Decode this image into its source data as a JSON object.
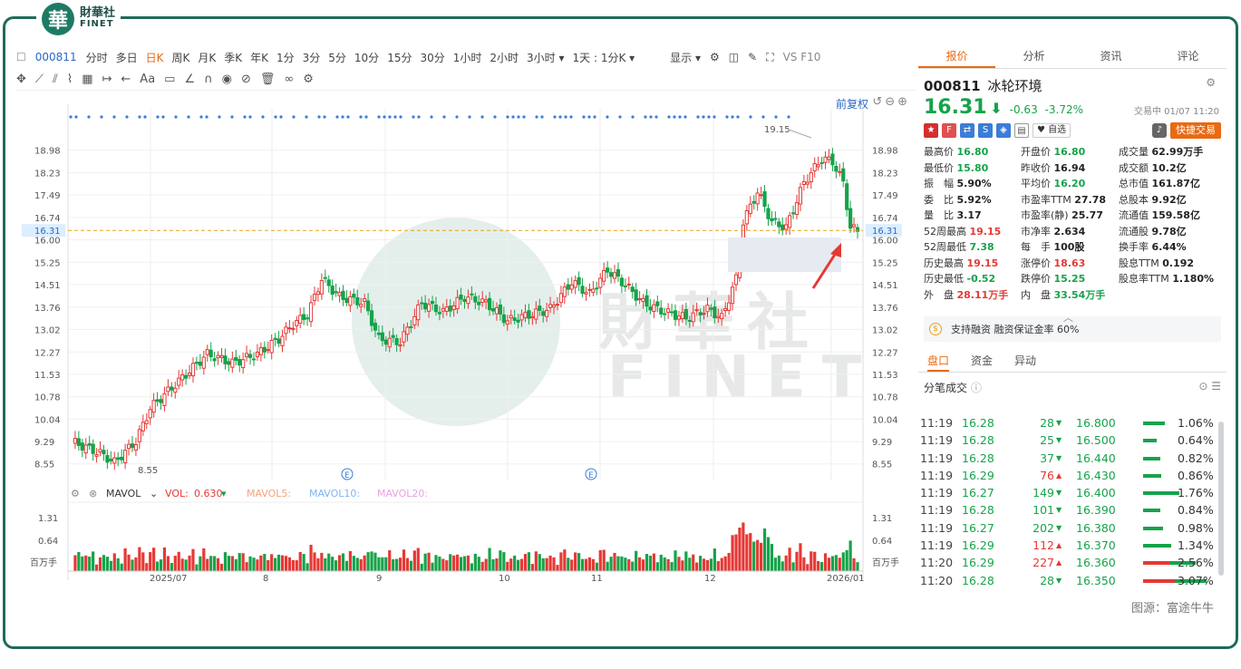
{
  "brand": {
    "logo_char": "華",
    "name_cn": "財華社",
    "name_en": "FINET",
    "watermark_cn": "財華社",
    "watermark_en": "FINET"
  },
  "toolbar": {
    "code": "000811",
    "items": [
      "分时",
      "多日",
      "日K",
      "周K",
      "月K",
      "季K",
      "年K",
      "1分",
      "3分",
      "5分",
      "10分",
      "15分",
      "30分",
      "1小时",
      "2小时",
      "3小时 ▾",
      "1天 : 1分K ▾"
    ],
    "active": "日K",
    "display": "显示 ▾",
    "right": "VS F10"
  },
  "chart": {
    "restore_label": "前复权",
    "y_ticks": [
      "18.98",
      "18.23",
      "17.49",
      "16.74",
      "16.00",
      "15.25",
      "14.51",
      "13.76",
      "13.02",
      "12.27",
      "11.53",
      "10.78",
      "10.04",
      "9.29",
      "8.55"
    ],
    "current_price_label": "16.31",
    "high_label": "19.15",
    "low_label": "8.55",
    "x_labels": [
      "2025/07",
      "8",
      "9",
      "10",
      "11",
      "12",
      "2026/01"
    ],
    "event_marker": "E"
  },
  "vol_panel": {
    "label": "MAVOL",
    "vol_label": "VOL:",
    "vol_value": "0.630",
    "ma5": "MAVOL5:",
    "ma10": "MAVOL10:",
    "ma20": "MAVOL20:",
    "y_ticks": [
      "1.31",
      "0.64"
    ],
    "unit": "百万手"
  },
  "right": {
    "tabs": [
      "报价",
      "分析",
      "资讯",
      "评论"
    ],
    "code": "000811",
    "name": "冰轮环境",
    "price": "16.31",
    "arrow": "⬇",
    "change": "-0.63",
    "change_pct": "-3.72%",
    "status": "交易中 01/07 11:20",
    "watch": "♥ 自选",
    "quick_trade": "快捷交易",
    "stats": [
      [
        "最高价",
        "16.80",
        "g"
      ],
      [
        "开盘价",
        "16.80",
        "g"
      ],
      [
        "成交量",
        "62.99万手",
        ""
      ],
      [
        "最低价",
        "15.80",
        "g"
      ],
      [
        "昨收价",
        "16.94",
        ""
      ],
      [
        "成交额",
        "10.2亿",
        ""
      ],
      [
        "振　幅",
        "5.90%",
        ""
      ],
      [
        "平均价",
        "16.20",
        "g"
      ],
      [
        "总市值",
        "161.87亿",
        ""
      ],
      [
        "委　比",
        "5.92%",
        ""
      ],
      [
        "市盈率TTM",
        "27.78",
        ""
      ],
      [
        "总股本",
        "9.92亿",
        ""
      ],
      [
        "量　比",
        "3.17",
        ""
      ],
      [
        "市盈率(静)",
        "25.77",
        ""
      ],
      [
        "流通值",
        "159.58亿",
        ""
      ],
      [
        "52周最高",
        "19.15",
        "r"
      ],
      [
        "市净率",
        "2.634",
        ""
      ],
      [
        "流通股",
        "9.78亿",
        ""
      ],
      [
        "52周最低",
        "7.38",
        "g"
      ],
      [
        "每　手",
        "100股",
        ""
      ],
      [
        "换手率",
        "6.44%",
        ""
      ],
      [
        "历史最高",
        "19.15",
        "r"
      ],
      [
        "涨停价",
        "18.63",
        "r"
      ],
      [
        "股息TTM",
        "0.192",
        ""
      ],
      [
        "历史最低",
        "-0.52",
        "g"
      ],
      [
        "跌停价",
        "15.25",
        "g"
      ],
      [
        "股息率TTM",
        "1.180%",
        ""
      ],
      [
        "外　盘",
        "28.11万手",
        "r"
      ],
      [
        "内　盘",
        "33.54万手",
        "g"
      ]
    ],
    "margin_text": "支持融资 融资保证金率 60%",
    "subtabs": [
      "盘口",
      "资金",
      "异动"
    ],
    "trades_title": "分笔成交",
    "trades": [
      {
        "time": "11:19",
        "price": "16.28",
        "vol": "28",
        "dir": "down"
      },
      {
        "time": "11:19",
        "price": "16.28",
        "vol": "25",
        "dir": "down"
      },
      {
        "time": "11:19",
        "price": "16.28",
        "vol": "37",
        "dir": "down"
      },
      {
        "time": "11:19",
        "price": "16.29",
        "vol": "76",
        "dir": "up"
      },
      {
        "time": "11:19",
        "price": "16.27",
        "vol": "149",
        "dir": "down"
      },
      {
        "time": "11:19",
        "price": "16.28",
        "vol": "101",
        "dir": "down"
      },
      {
        "time": "11:19",
        "price": "16.27",
        "vol": "202",
        "dir": "down"
      },
      {
        "time": "11:19",
        "price": "16.29",
        "vol": "112",
        "dir": "up"
      },
      {
        "time": "11:20",
        "price": "16.29",
        "vol": "227",
        "dir": "up"
      },
      {
        "time": "11:20",
        "price": "16.28",
        "vol": "28",
        "dir": "down"
      }
    ],
    "depth": [
      {
        "price": "16.800",
        "pct": "1.06%",
        "v": 1.06
      },
      {
        "price": "16.500",
        "pct": "0.64%",
        "v": 0.64
      },
      {
        "price": "16.440",
        "pct": "0.82%",
        "v": 0.82
      },
      {
        "price": "16.430",
        "pct": "0.86%",
        "v": 0.86
      },
      {
        "price": "16.400",
        "pct": "1.76%",
        "v": 1.76
      },
      {
        "price": "16.390",
        "pct": "0.84%",
        "v": 0.84
      },
      {
        "price": "16.380",
        "pct": "0.98%",
        "v": 0.98
      },
      {
        "price": "16.370",
        "pct": "1.34%",
        "v": 1.34
      },
      {
        "price": "16.360",
        "pct": "2.56%",
        "v": 2.56
      },
      {
        "price": "16.350",
        "pct": "3.07%",
        "v": 3.07
      }
    ]
  },
  "source": "图源：富途牛牛"
}
